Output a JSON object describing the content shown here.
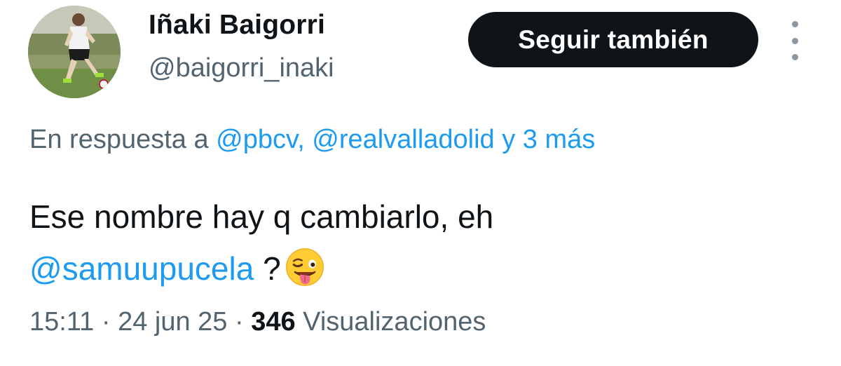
{
  "author": {
    "name": "Iñaki Baigorri",
    "handle": "@baigorri_inaki"
  },
  "follow_button": {
    "label": "Seguir también"
  },
  "reply_context": {
    "prefix": "En respuesta a ",
    "mentions": "@pbcv, @realvalladolid y 3 más"
  },
  "tweet": {
    "line1": "Ese nombre hay q cambiarlo, eh",
    "mention": "@samuupucela",
    "after_mention": " ?",
    "emoji": "winking-face-with-tongue"
  },
  "meta": {
    "time": "15:11",
    "separator": " · ",
    "date": "24 jun 25",
    "views_count": "346",
    "views_label": " Visualizaciones"
  },
  "colors": {
    "text": "#0f1419",
    "secondary": "#536471",
    "link": "#1d9bf0",
    "button_bg": "#0f1419",
    "button_text": "#ffffff"
  }
}
